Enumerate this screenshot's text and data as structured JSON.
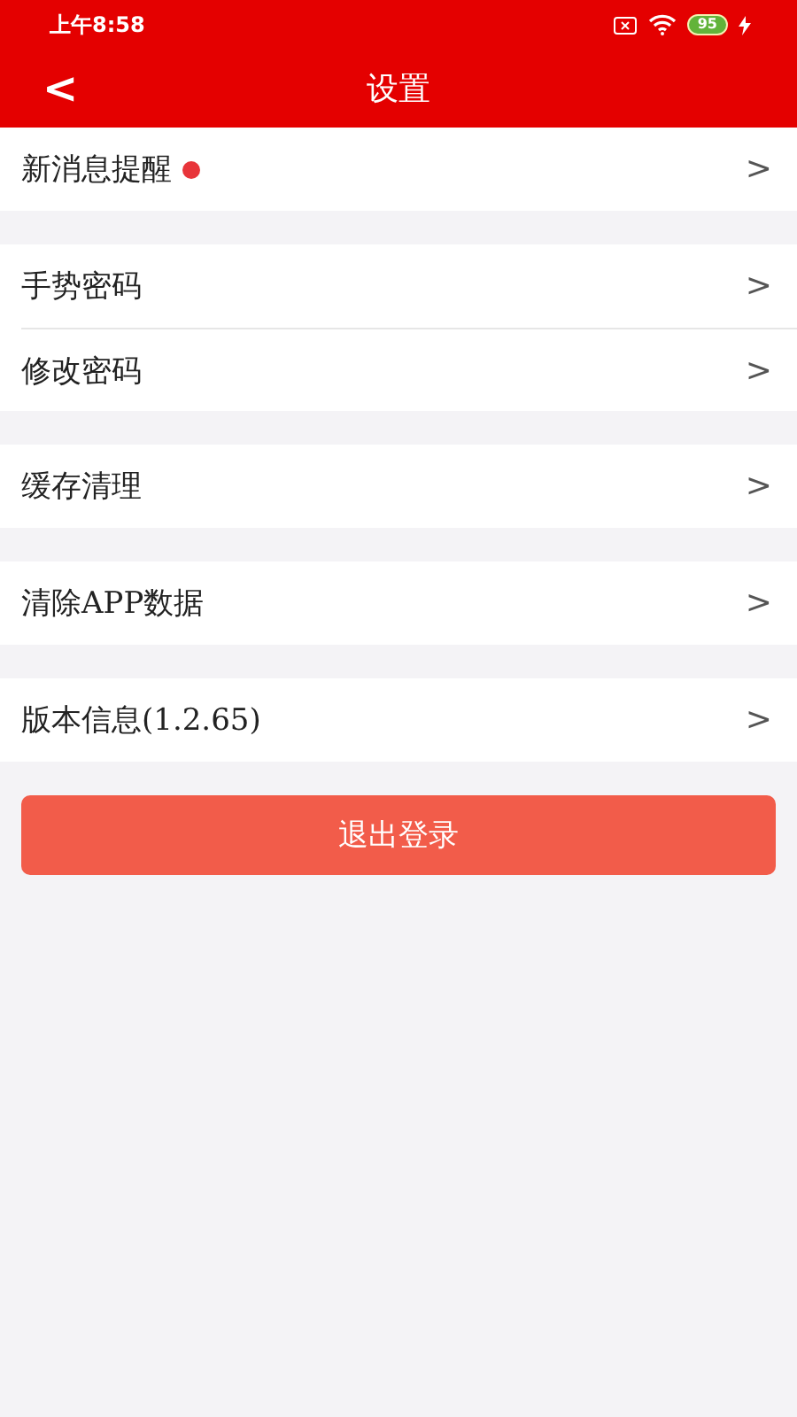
{
  "status_bar": {
    "time": "上午8:58",
    "battery": "95",
    "charging": true
  },
  "header": {
    "back": "<",
    "title": "设置"
  },
  "groups": [
    {
      "items": [
        {
          "label": "新消息提醒",
          "badge": true,
          "chevron": ">"
        }
      ]
    },
    {
      "items": [
        {
          "label": "手势密码",
          "badge": false,
          "chevron": ">"
        },
        {
          "label": "修改密码",
          "badge": false,
          "chevron": ">"
        }
      ]
    },
    {
      "items": [
        {
          "label": "缓存清理",
          "badge": false,
          "chevron": ">"
        }
      ]
    },
    {
      "items": [
        {
          "label": "清除APP数据",
          "badge": false,
          "chevron": ">"
        }
      ]
    },
    {
      "items": [
        {
          "label": "版本信息(1.2.65)",
          "badge": false,
          "chevron": ">"
        }
      ]
    }
  ],
  "logout_button": "退出登录"
}
